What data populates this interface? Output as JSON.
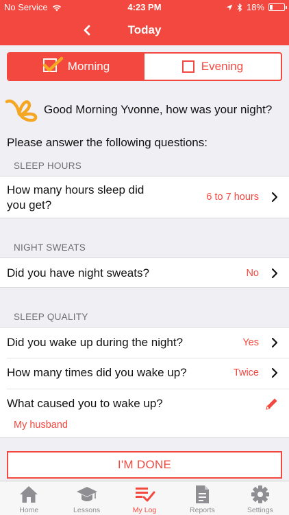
{
  "colors": {
    "accent": "#f2483f",
    "logo": "#f5a623",
    "background": "#efeff4"
  },
  "status_bar": {
    "carrier": "No Service",
    "time": "4:23 PM",
    "battery": "18%"
  },
  "nav": {
    "title": "Today",
    "back_icon": "chevron-left-icon"
  },
  "segments": [
    {
      "label": "Morning",
      "selected": true,
      "icon": "check-icon"
    },
    {
      "label": "Evening",
      "selected": false,
      "icon": "empty-checkbox-icon"
    }
  ],
  "greeting": {
    "text": "Good Morning Yvonne, how was your night?",
    "logo_icon": "butterfly-logo-icon"
  },
  "instructions": "Please answer the following questions:",
  "sections": [
    {
      "header": "SLEEP HOURS",
      "rows": [
        {
          "label": "How many hours sleep did you get?",
          "label_lines": [
            "How many hours sleep did",
            "you get?"
          ],
          "value": "6 to 7 hours"
        }
      ]
    },
    {
      "header": "NIGHT SWEATS",
      "rows": [
        {
          "label": "Did you have night sweats?",
          "value": "No"
        }
      ]
    },
    {
      "header": "SLEEP QUALITY",
      "rows": [
        {
          "label": "Did you wake up during the night?",
          "value": "Yes"
        },
        {
          "label": "How many times did you wake up?",
          "value": "Twice"
        },
        {
          "label": "What caused you to wake up?",
          "answer": "My husband",
          "icon": "pencil-icon"
        }
      ]
    }
  ],
  "done_button": "I'M DONE",
  "tabs": [
    {
      "label": "Home",
      "icon": "home-icon",
      "active": false
    },
    {
      "label": "Lessons",
      "icon": "graduation-cap-icon",
      "active": false
    },
    {
      "label": "My Log",
      "icon": "checklist-icon",
      "active": true
    },
    {
      "label": "Reports",
      "icon": "document-icon",
      "active": false
    },
    {
      "label": "Settings",
      "icon": "gear-icon",
      "active": false
    }
  ]
}
